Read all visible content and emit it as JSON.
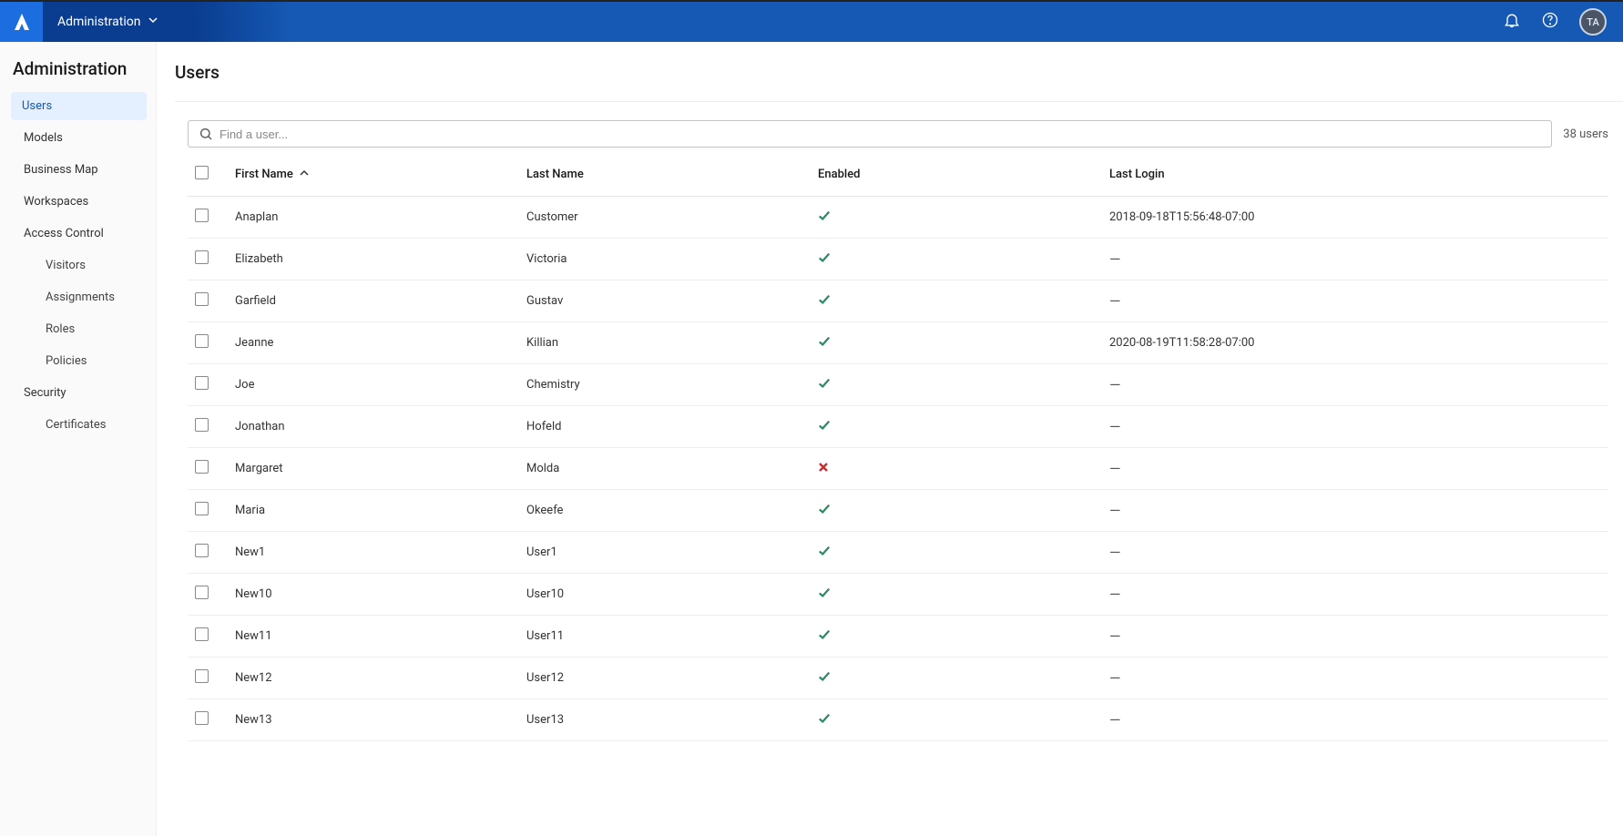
{
  "topbar": {
    "title": "Administration",
    "avatar_initials": "TA"
  },
  "sidebar": {
    "header": "Administration",
    "items": [
      {
        "label": "Users",
        "active": true,
        "sub": false
      },
      {
        "label": "Models",
        "active": false,
        "sub": false
      },
      {
        "label": "Business Map",
        "active": false,
        "sub": false
      },
      {
        "label": "Workspaces",
        "active": false,
        "sub": false
      },
      {
        "label": "Access Control",
        "active": false,
        "sub": false
      },
      {
        "label": "Visitors",
        "active": false,
        "sub": true
      },
      {
        "label": "Assignments",
        "active": false,
        "sub": true
      },
      {
        "label": "Roles",
        "active": false,
        "sub": true
      },
      {
        "label": "Policies",
        "active": false,
        "sub": true
      },
      {
        "label": "Security",
        "active": false,
        "sub": false
      },
      {
        "label": "Certificates",
        "active": false,
        "sub": true
      }
    ]
  },
  "page": {
    "title": "Users",
    "search_placeholder": "Find a user...",
    "users_count_label": "38 users"
  },
  "table": {
    "columns": {
      "first_name": "First Name",
      "last_name": "Last Name",
      "enabled": "Enabled",
      "last_login": "Last Login"
    },
    "sort_column": "first_name",
    "sort_dir": "asc",
    "rows": [
      {
        "first": "Anaplan",
        "last": "Customer",
        "enabled": true,
        "last_login": "2018-09-18T15:56:48-07:00"
      },
      {
        "first": "Elizabeth",
        "last": "Victoria",
        "enabled": true,
        "last_login": "—"
      },
      {
        "first": "Garfield",
        "last": "Gustav",
        "enabled": true,
        "last_login": "—"
      },
      {
        "first": "Jeanne",
        "last": "Killian",
        "enabled": true,
        "last_login": "2020-08-19T11:58:28-07:00"
      },
      {
        "first": "Joe",
        "last": "Chemistry",
        "enabled": true,
        "last_login": "—"
      },
      {
        "first": "Jonathan",
        "last": "Hofeld",
        "enabled": true,
        "last_login": "—"
      },
      {
        "first": "Margaret",
        "last": "Molda",
        "enabled": false,
        "last_login": "—"
      },
      {
        "first": "Maria",
        "last": "Okeefe",
        "enabled": true,
        "last_login": "—"
      },
      {
        "first": "New1",
        "last": "User1",
        "enabled": true,
        "last_login": "—"
      },
      {
        "first": "New10",
        "last": "User10",
        "enabled": true,
        "last_login": "—"
      },
      {
        "first": "New11",
        "last": "User11",
        "enabled": true,
        "last_login": "—"
      },
      {
        "first": "New12",
        "last": "User12",
        "enabled": true,
        "last_login": "—"
      },
      {
        "first": "New13",
        "last": "User13",
        "enabled": true,
        "last_login": "—"
      }
    ]
  }
}
